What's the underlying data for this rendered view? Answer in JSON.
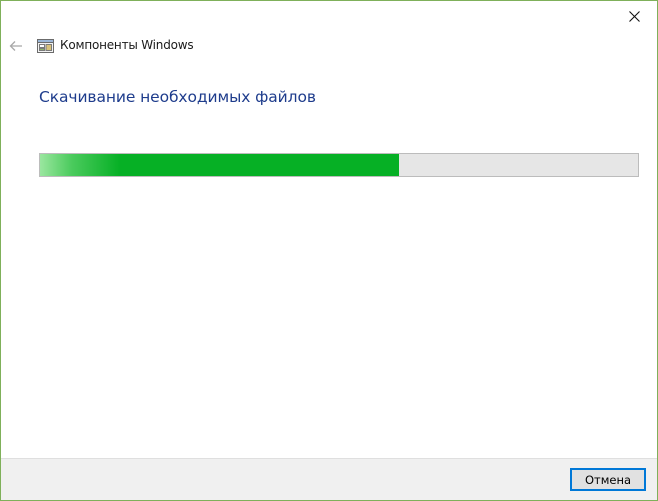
{
  "window": {
    "title": "Компоненты Windows",
    "border_color": "#7fb05a"
  },
  "icons": {
    "close": "close-icon",
    "back": "back-arrow-icon",
    "app": "windows-features-icon"
  },
  "main": {
    "heading": "Скачивание необходимых файлов",
    "heading_color": "#1e3c8c"
  },
  "progress": {
    "value": 0.6,
    "fill_color": "#06b025",
    "track_color": "#e6e6e6"
  },
  "footer": {
    "cancel_label": "Отмена"
  }
}
